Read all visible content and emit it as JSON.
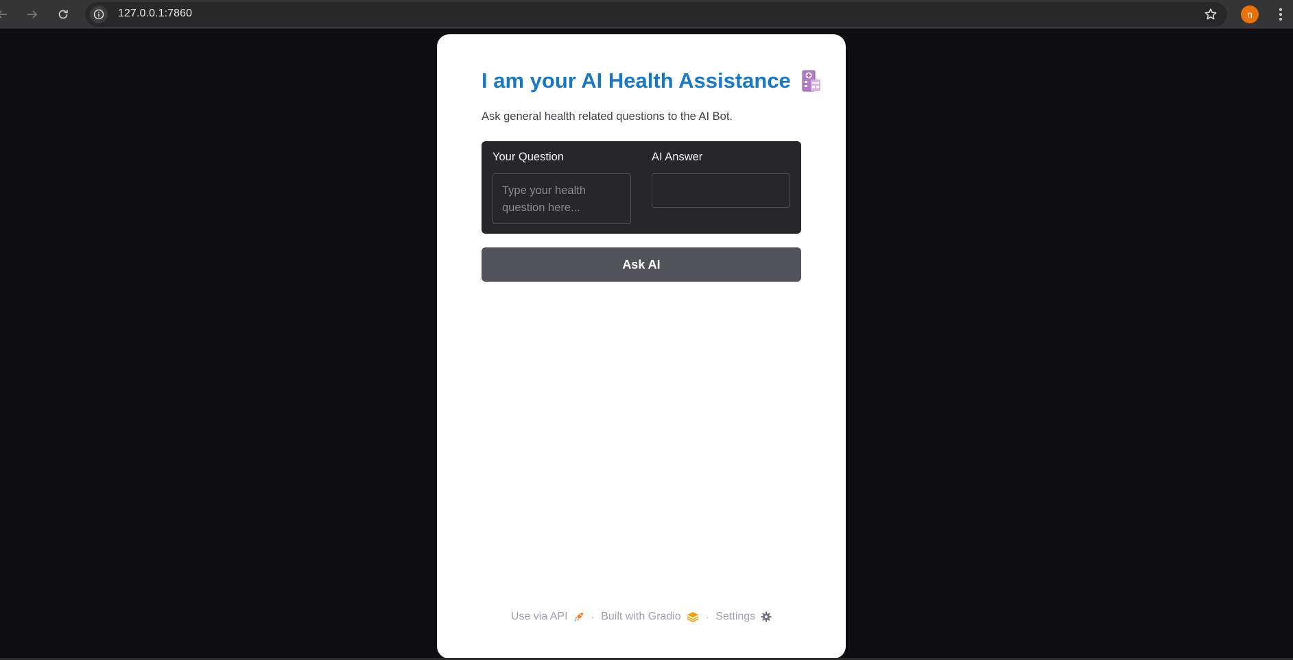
{
  "browser": {
    "url": "127.0.0.1:7860",
    "profile_initial": "n",
    "profile_color": "#e8710a"
  },
  "app": {
    "title": "I am your AI Health Assistance",
    "title_icon": "hospital-icon",
    "subtitle": "Ask general health related questions to the AI Bot.",
    "question": {
      "label": "Your Question",
      "value": "",
      "placeholder": "Type your health question here..."
    },
    "answer": {
      "label": "AI Answer",
      "value": ""
    },
    "ask_button_label": "Ask AI",
    "accent_color": "#1a78c2"
  },
  "footer": {
    "api_label": "Use via API",
    "gradio_label": "Built with Gradio",
    "settings_label": "Settings",
    "separator": "·"
  }
}
